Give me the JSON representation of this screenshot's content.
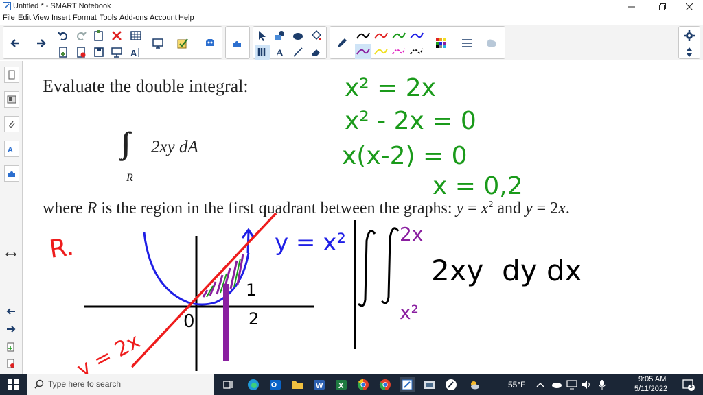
{
  "window": {
    "title": "Untitled * - SMART Notebook",
    "menu": [
      "File",
      "Edit",
      "View",
      "Insert",
      "Format",
      "Tools",
      "Add-ons",
      "Account",
      "Help"
    ]
  },
  "page": {
    "heading": "Evaluate the double integral:",
    "integral_sub": "R",
    "integrand": "2xy dA",
    "where_pre": "where ",
    "where_R": "R",
    "where_mid": " is the region in the first quadrant between the graphs: ",
    "eq1_y": "y",
    "eq1_eq": " = ",
    "eq1_x": "x",
    "eq1_exp": "2",
    "and_word": " and ",
    "eq2_y": "y",
    "eq2_rest": " = 2",
    "eq2_x": "x",
    "eq2_end": "."
  },
  "handwriting": {
    "work1": "x² = 2x",
    "work2": "x² - 2x = 0",
    "work3": "x(x-2) = 0",
    "work4": "x = 0,2",
    "region_label": "R.",
    "curve_label": "y = x²",
    "line_label": "y = 2x",
    "tick_0": "0",
    "tick_2": "2",
    "tick_1": "1",
    "integral_upper": "2x",
    "integral_lower": "x²",
    "integral_body": "2xy  dy dx"
  },
  "taskbar": {
    "search_placeholder": "Type here to search",
    "weather": "55°F",
    "time": "9:05 AM",
    "date": "5/11/2022",
    "notifications": "3"
  },
  "colors": {
    "green_ink": "#1a9a1a",
    "blue_ink": "#1f1fe6",
    "red_ink": "#ee1c1c",
    "purple_ink": "#8a1fa0",
    "taskbar": "#1b2636"
  }
}
